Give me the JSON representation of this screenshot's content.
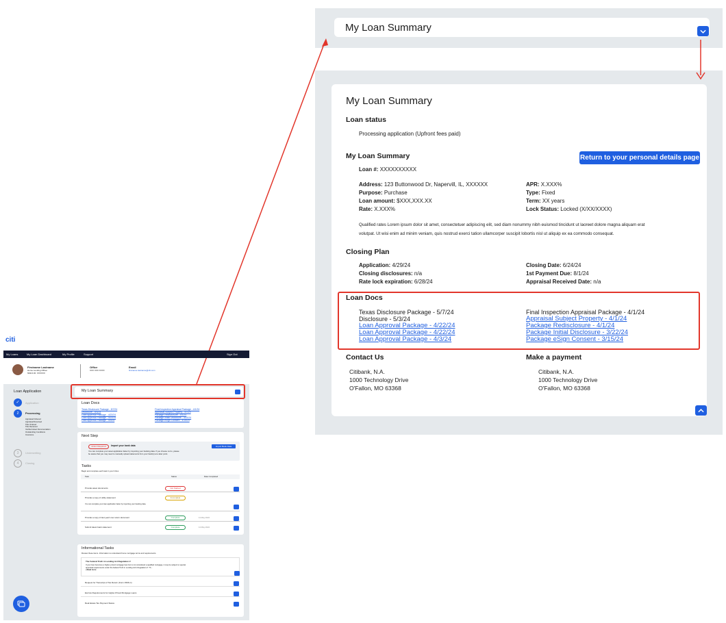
{
  "top_panel": {
    "title": "My Loan Summary"
  },
  "detail": {
    "title": "My Loan Summary",
    "loan_status": {
      "heading": "Loan status",
      "value": "Processing application (Upfront fees paid)"
    },
    "summary": {
      "heading": "My Loan Summary",
      "return_button": "Return to your personal details page",
      "loan_no_label": "Loan #:",
      "loan_no": "XXXXXXXXXX",
      "left": [
        {
          "label": "Address:",
          "value": "123 Buttonwood Dr, Napervill, IL, XXXXXX"
        },
        {
          "label": "Purpose:",
          "value": "Purchase"
        },
        {
          "label": "Loan amount:",
          "value": "$XXX,XXX.XX"
        },
        {
          "label": "Rate:",
          "value": "X.XXX%"
        }
      ],
      "right": [
        {
          "label": "APR:",
          "value": "X.XXX%"
        },
        {
          "label": "Type:",
          "value": "Fixed"
        },
        {
          "label": "Term:",
          "value": "XX years"
        },
        {
          "label": "Lock Status:",
          "value": "Locked (X/XX/XXXX)"
        }
      ],
      "note_line1": "Qualified rates Lorem ipsum dolor sit amet, consectetuer adipiscing elit, sed diam nonummy nibh euismod tincidunt ut laoreet dolore magna aliquam erat",
      "note_line2": "volutpat. Ut wisi enim ad minim veniam, quis nostrud exerci tation ullamcorper suscipit lobortis nisl ut aliquip ex ea commodo consequat."
    },
    "closing": {
      "heading": "Closing Plan",
      "left": [
        {
          "label": "Application:",
          "value": "4/29/24"
        },
        {
          "label": "Closing disclosures:",
          "value": "n/a"
        },
        {
          "label": "Rate lock expiration:",
          "value": "6/28/24"
        }
      ],
      "right": [
        {
          "label": "Closing Date:",
          "value": "6/24/24"
        },
        {
          "label": "1st Payment Due:",
          "value": "8/1/24"
        },
        {
          "label": "Appraisal Received Date:",
          "value": "n/a"
        }
      ]
    },
    "loan_docs": {
      "heading": "Loan Docs",
      "left_plain": [
        "Texas Disclosure Package - 5/7/24",
        "Disclosure - 5/3/24"
      ],
      "left_links": [
        "Loan Approval Package - 4/22/24",
        "Loan Approval Package - 4/22/24",
        "Loan Approval Package - 4/3/24"
      ],
      "right_plain": [
        "Final Inspection Appraisal Package - 4/1/24"
      ],
      "right_links": [
        "Appraisal Subject Property - 4/1/24",
        "Package Redisclosure - 4/1/24",
        "Package Initial Disclosure - 3/22/24",
        "Package eSign Consent - 3/15/24"
      ]
    },
    "contact": {
      "heading": "Contact Us",
      "lines": [
        "Citibank, N.A.",
        "1000 Technology Drive",
        "O'Fallon, MO 63368"
      ]
    },
    "payment": {
      "heading": "Make a payment",
      "lines": [
        "Citibank, N.A.",
        "1000 Technology Drive",
        "O'Fallon, MO 63368"
      ]
    }
  },
  "mini_app": {
    "logo": "citi",
    "nav": [
      "My Loans",
      "My Loan Dashboard",
      "My Profile",
      "Support"
    ],
    "sign_out": "Sign Out",
    "officer": {
      "name": "Firstname Lastname",
      "role": "Home Lending Officer",
      "id": "NMLS ID: XXXXXX"
    },
    "office": {
      "label": "Office",
      "value": "XXX XXX XXXX"
    },
    "email": {
      "label": "Email",
      "value": "firstname.lastname@citi.com"
    },
    "sidebar": {
      "title": "Loan Application",
      "steps": [
        {
          "num": "1",
          "label": "Application"
        },
        {
          "num": "2",
          "label": "Processing"
        },
        {
          "num": "3",
          "label": "Underwriting"
        },
        {
          "num": "4",
          "label": "Closing"
        }
      ],
      "substeps": [
        "Appraisal Ordered",
        "Appraisal Received",
        "Title Ordered",
        "Title Received",
        "Verified Asset Documentation",
        "Outstanding Conditions",
        "Insurance"
      ]
    },
    "summary_title": "My Loan Summary",
    "docs_title": "Loan Docs",
    "docs_left": [
      "Texas Disclosure Package - 5/7/24",
      "Disclosure - 5/3/24",
      "Loan Approval Package - 4/22/24",
      "Loan Approval Package - 4/22/24",
      "Loan Approval Package - 4/3/24"
    ],
    "docs_right": [
      "Final Inspection Appraisal Package - 4/1/24",
      "Appraisal Subject Property - 4/1/24",
      "Package Redisclosure - 4/1/24",
      "Package Initial Disclosure - 3/22/24",
      "Package eSign Consent - 3/15/24"
    ],
    "next_step": {
      "title": "Next Step",
      "badge": "Action Required",
      "heading": "Import your bank data",
      "text1": "You can complete your asset application faster by importing your banking data. If you choose not to, please",
      "text2": "be aware that you may need to manually upload statements from your bank(s) at a later point.",
      "button": "Import Bank Data"
    },
    "tasks": {
      "title": "Tasks",
      "subtitle": "Begin and complete each task in your Inbox.",
      "columns": [
        "Task",
        "Status",
        "Date Completed"
      ],
      "rows": [
        {
          "task": "Provide asset documents",
          "status": "Not Started",
          "date": ""
        },
        {
          "task": "Provide a copy of utility statement",
          "status": "Incomplete",
          "date": ""
        },
        {
          "task": "Provide a copy of last year's tax return document",
          "status": "Complete",
          "date": "11 May 2024"
        },
        {
          "task": "Submit latest bank statement",
          "status": "Complete",
          "date": "11 May 2024"
        }
      ],
      "utility_note": "You can complete your loan application faster by importing your banking data."
    },
    "info_tasks": {
      "title": "Informational Tasks",
      "subtitle": "Review these items. Information to understand home mortgage terms and requirements.",
      "items": [
        {
          "title": "The Federal Truth in Lending Act Regulation Z",
          "body1": "If your loan becomes a higher-priced mortgage loan but is not considered a qualified mortgage, it may be subject to special",
          "body2": "appraisal requirements under the federal Truth in Lending Act's Regulation Z. Th...",
          "more": "+Read more"
        },
        {
          "title": "Request for Transcript of Tax Return (Form 4506-C)"
        },
        {
          "title": "Escrow Requirements for Higher-Priced Mortgage Loans"
        },
        {
          "title": "Real Estate Tax Payment Status"
        }
      ]
    }
  },
  "colors": {
    "accent": "#1f5fe0",
    "highlight": "#e2352a",
    "nav": "#141a33",
    "panel": "#e5e9ec"
  }
}
